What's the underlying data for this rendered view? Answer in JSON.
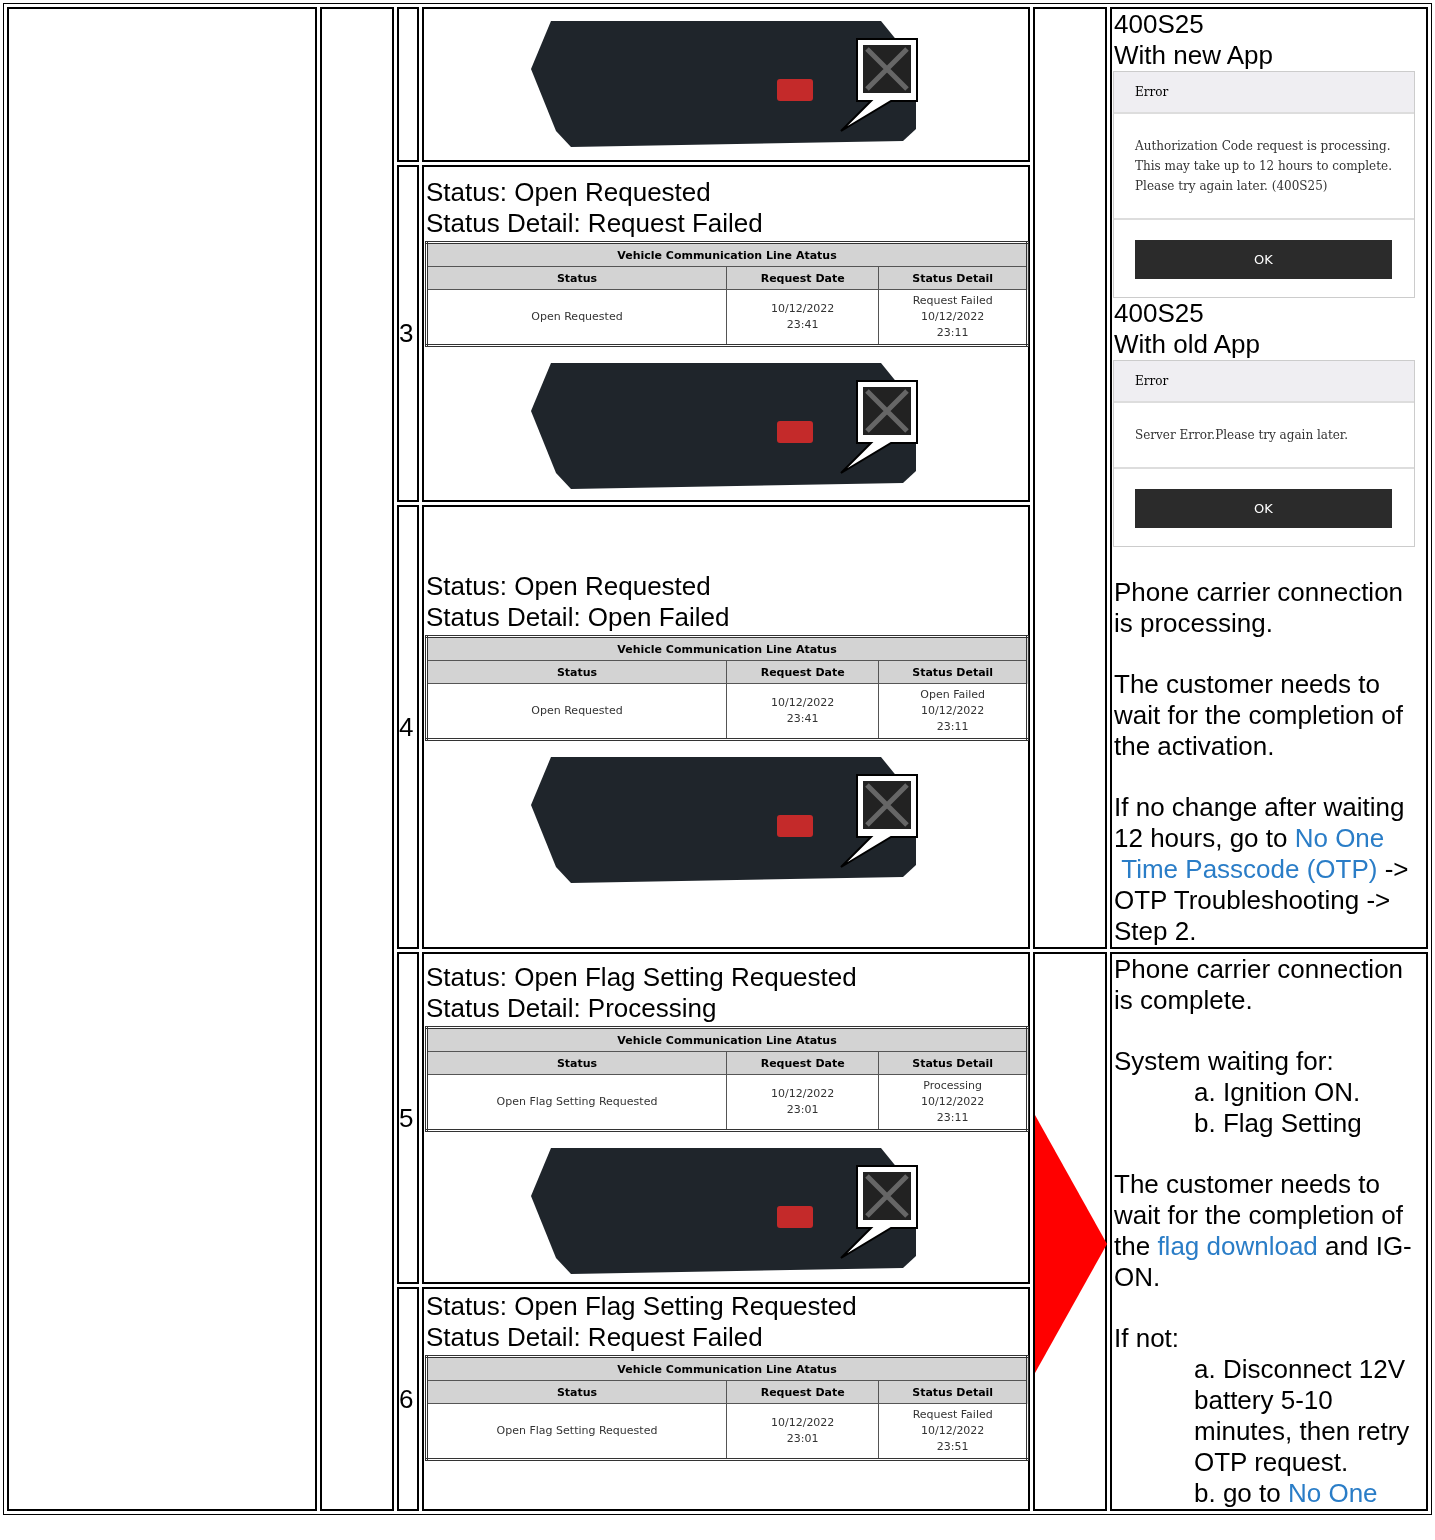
{
  "rows": [
    {
      "blocks": [
        {
          "kind": "photo"
        }
      ],
      "note": {
        "pointer": false,
        "blocks": [
          {
            "kind": "caption",
            "lines": [
              "400S25",
              "With new App"
            ]
          },
          {
            "kind": "dialog",
            "title": "Error",
            "message": "Authorization Code request is processing.\nThis may take up to 12 hours to complete.\nPlease try again later. (400S25)",
            "button": "OK"
          },
          {
            "kind": "caption",
            "lines": [
              "400S25",
              "With old App"
            ]
          },
          {
            "kind": "dialog",
            "title": "Error",
            "message": "Server Error.Please try again later.",
            "button": "OK"
          },
          {
            "kind": "paragraph",
            "segments": [
              {
                "text": "Phone carrier connection is processing.",
                "link": false
              }
            ]
          },
          {
            "kind": "paragraph",
            "segments": [
              {
                "text": "The customer needs to wait for the completion of the activation.",
                "link": false
              }
            ]
          },
          {
            "kind": "paragraph",
            "segments": [
              {
                "text": "If no change after waiting 12 hours, go to ",
                "link": false
              },
              {
                "text": "No One",
                "link": true
              },
              {
                "text": "Time Passcode (OTP)",
                "link": true
              },
              {
                "text": " -> OTP Troubleshooting -> Step 2.",
                "link": false
              }
            ]
          }
        ]
      }
    },
    {
      "number": "3",
      "blocks": [
        {
          "kind": "status_text",
          "lines": [
            "Status: Open Requested",
            "Status Detail: Request Failed"
          ]
        },
        {
          "kind": "status_table",
          "title": "Vehicle Communication Line Atatus",
          "columns": [
            "Status",
            "Request Date",
            "Status Detail"
          ],
          "cells": [
            "Open Requested",
            "10/12/2022\n23:41",
            "Request Failed\n10/12/2022\n23:11"
          ]
        },
        {
          "kind": "photo"
        }
      ]
    },
    {
      "number": "4",
      "blocks": [
        {
          "kind": "status_text",
          "lines": [
            "Status: Open Requested",
            "Status Detail: Open Failed"
          ]
        },
        {
          "kind": "status_table",
          "title": "Vehicle Communication Line Atatus",
          "columns": [
            "Status",
            "Request Date",
            "Status Detail"
          ],
          "cells": [
            "Open Requested",
            "10/12/2022\n23:41",
            "Open Failed\n10/12/2022\n23:11"
          ]
        },
        {
          "kind": "photo"
        }
      ]
    },
    {
      "number": "5",
      "blocks": [
        {
          "kind": "status_text",
          "lines": [
            "Status: Open Flag Setting Requested",
            "Status Detail: Processing"
          ]
        },
        {
          "kind": "status_table",
          "title": "Vehicle Communication Line Atatus",
          "columns": [
            "Status",
            "Request Date",
            "Status Detail"
          ],
          "cells": [
            "Open Flag Setting Requested",
            "10/12/2022\n23:01",
            "Processing\n10/12/2022\n23:11"
          ]
        },
        {
          "kind": "photo"
        }
      ],
      "note": {
        "pointer": true,
        "blocks": [
          {
            "kind": "paragraph",
            "segments": [
              {
                "text": "Phone carrier connection is complete.",
                "link": false
              }
            ]
          },
          {
            "kind": "paragraph",
            "segments": [
              {
                "text": "System waiting for:",
                "link": false
              }
            ]
          },
          {
            "kind": "list",
            "items": [
              [
                {
                  "text": "a. Ignition ON.",
                  "link": false
                }
              ],
              [
                {
                  "text": "b. Flag Setting",
                  "link": false
                }
              ]
            ]
          },
          {
            "kind": "paragraph",
            "segments": [
              {
                "text": "The customer needs to wait for the completion of the ",
                "link": false
              },
              {
                "text": "flag download",
                "link": true
              },
              {
                "text": " and IG-ON.",
                "link": false
              }
            ]
          },
          {
            "kind": "paragraph",
            "segments": [
              {
                "text": "If not:",
                "link": false
              }
            ]
          },
          {
            "kind": "list",
            "items": [
              [
                {
                  "text": "a. Disconnect 12V battery 5-10 minutes, then retry OTP request.",
                  "link": false
                }
              ],
              [
                {
                  "text": "b. go to  ",
                  "link": false
                },
                {
                  "text": "No One",
                  "link": true
                }
              ]
            ]
          }
        ]
      }
    },
    {
      "number": "6",
      "blocks": [
        {
          "kind": "status_text",
          "lines": [
            "Status: Open Flag Setting Requested",
            "Status Detail: Request Failed"
          ]
        },
        {
          "kind": "status_table",
          "title": "Vehicle Communication Line Atatus",
          "columns": [
            "Status",
            "Request Date",
            "Status Detail"
          ],
          "cells": [
            "Open Flag Setting Requested",
            "10/12/2022\n23:01",
            "Request Failed\n10/12/2022\n23:51"
          ]
        }
      ]
    }
  ]
}
